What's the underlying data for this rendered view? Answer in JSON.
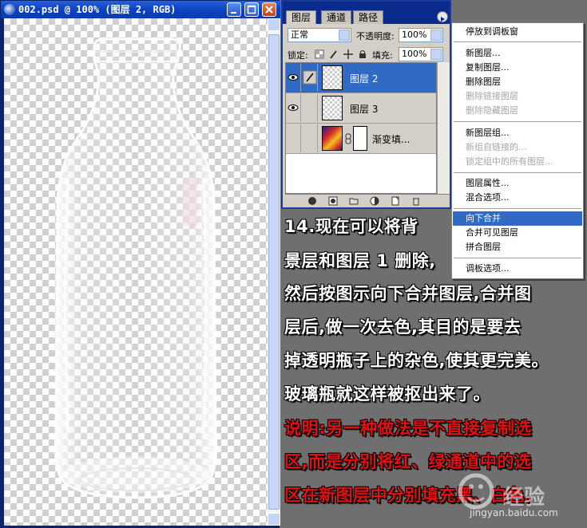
{
  "document": {
    "title": "002.psd @ 100% (图层 2, RGB)"
  },
  "layers_panel": {
    "tabs": [
      "图层",
      "通道",
      "路径"
    ],
    "blend_mode": "正常",
    "opacity_label": "不透明度:",
    "opacity_value": "100%",
    "lock_label": "锁定:",
    "fill_label": "填充:",
    "fill_value": "100%",
    "layers": [
      {
        "name": "图层 2",
        "selected": true,
        "visible": true
      },
      {
        "name": "图层 3",
        "selected": false,
        "visible": true
      },
      {
        "name": "渐变填...",
        "selected": false,
        "visible": false
      }
    ]
  },
  "context_menu": {
    "items": [
      {
        "label": "停放到调板窗",
        "disabled": false,
        "highlight": false
      },
      {
        "label": "新图层...",
        "disabled": false,
        "highlight": false
      },
      {
        "label": "复制图层...",
        "disabled": false,
        "highlight": false
      },
      {
        "label": "删除图层",
        "disabled": false,
        "highlight": false
      },
      {
        "label": "删除链接图层",
        "disabled": true,
        "highlight": false
      },
      {
        "label": "删除隐藏图层",
        "disabled": true,
        "highlight": false
      },
      {
        "label": "新图层组...",
        "disabled": false,
        "highlight": false
      },
      {
        "label": "新组自链接的...",
        "disabled": true,
        "highlight": false
      },
      {
        "label": "锁定组中的所有图层...",
        "disabled": true,
        "highlight": false
      },
      {
        "label": "图层属性...",
        "disabled": false,
        "highlight": false
      },
      {
        "label": "混合选项...",
        "disabled": false,
        "highlight": false
      },
      {
        "label": "向下合并",
        "disabled": false,
        "highlight": true
      },
      {
        "label": "合并可见图层",
        "disabled": false,
        "highlight": false
      },
      {
        "label": "拼合图层",
        "disabled": false,
        "highlight": false
      },
      {
        "label": "调板选项...",
        "disabled": false,
        "highlight": false
      }
    ]
  },
  "instructions": {
    "line1": "14.现在可以将背",
    "line2": "景层和图层 1 删除,",
    "line3": "然后按图示向下合并图层,合并图",
    "line4": "层后,做一次去色,其目的是要去",
    "line5": "掉透明瓶子上的杂色,使其更完美。",
    "line6": "玻璃瓶就这样被抠出来了。",
    "note1": "说明:另一种做法是不直接复制选",
    "note2": "区,而是分别将红、绿通道中的选",
    "note3": "区在新图层中分别填充黑、白色。"
  },
  "watermark": {
    "brand": "经验",
    "url": "jingyan.baidu.com"
  },
  "colors": {
    "titlebar": "#0b43c2",
    "selection": "#316ac5",
    "panel": "#d4d0c8",
    "background": "#6f6f6f",
    "note_text": "#e41010"
  }
}
